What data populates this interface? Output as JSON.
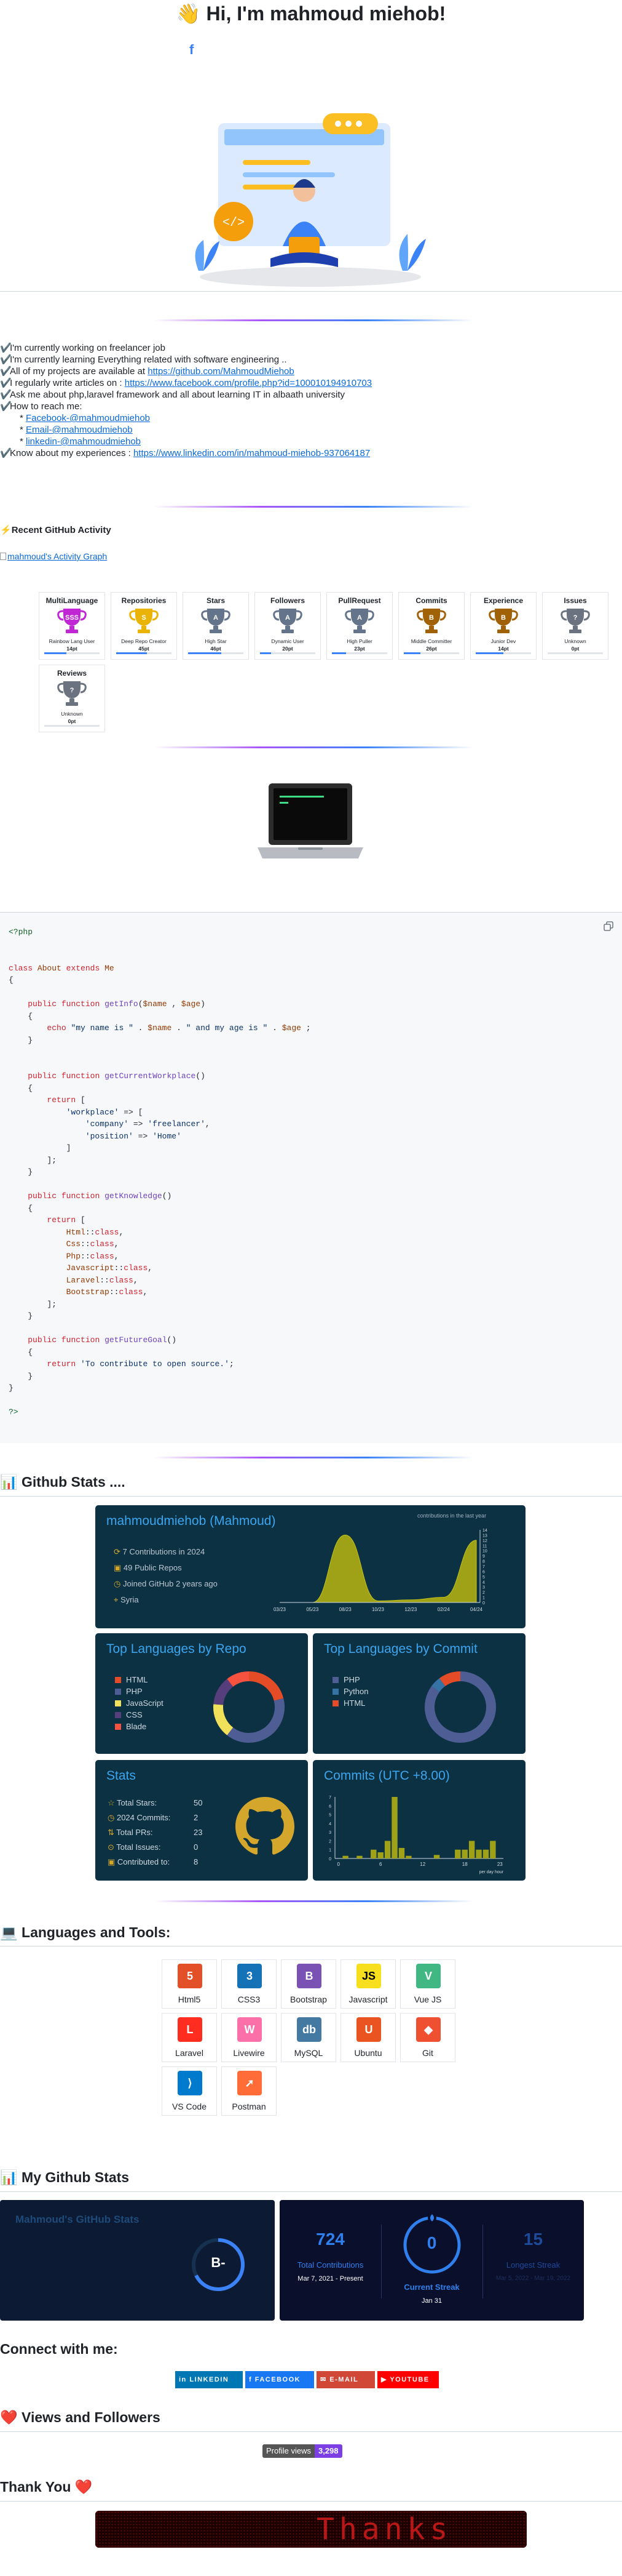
{
  "header": {
    "wave": "👋",
    "title": "Hi, I'm mahmoud miehob!",
    "fb_icon": "f"
  },
  "about": {
    "items": [
      {
        "check": "✔️",
        "text": "I'm currently working on freelancer job"
      },
      {
        "check": "✔️",
        "text": "I'm currently learning Everything related with software engineering .."
      },
      {
        "check": "✔️",
        "text": "All of my projects are available at ",
        "link": "https://github.com/MahmoudMiehob"
      },
      {
        "check": "✔️",
        "text": "I regularly write articles on : ",
        "link": "https://www.facebook.com/profile.php?id=100010194910703"
      },
      {
        "check": "✔️",
        "text": "Ask me about php,laravel framework and all about learning IT in albaath university"
      },
      {
        "check": "✔️",
        "text": "How to reach me:"
      }
    ],
    "contacts": [
      "Facebook-@mahmoudmiehob",
      "Email-@mahmoudmiehob",
      "linkedin-@mahmoudmiehob"
    ],
    "experience_prefix": "Know about my experiences : ",
    "experience_link": "https://www.linkedin.com/in/mahmoud-miehob-937064187"
  },
  "activity": {
    "icon": "⚡",
    "title": "Recent GitHub Activity",
    "graph_alt": "mahmoud's Activity Graph"
  },
  "trophies": [
    {
      "title": "MultiLanguage",
      "label": "Rainbow Lang User",
      "pts": "14pt",
      "rank": "SSS",
      "color": "#c026d3",
      "progress": 0.4
    },
    {
      "title": "Repositories",
      "label": "Deep Repo Creator",
      "pts": "45pt",
      "rank": "S",
      "color": "#eab308",
      "progress": 0.55
    },
    {
      "title": "Stars",
      "label": "High Star",
      "pts": "46pt",
      "rank": "A",
      "color": "#64748b",
      "progress": 0.6
    },
    {
      "title": "Followers",
      "label": "Dynamic User",
      "pts": "20pt",
      "rank": "A",
      "color": "#64748b",
      "progress": 0.2
    },
    {
      "title": "PullRequest",
      "label": "High Puller",
      "pts": "23pt",
      "rank": "A",
      "color": "#64748b",
      "progress": 0.25
    },
    {
      "title": "Commits",
      "label": "Middle Committer",
      "pts": "26pt",
      "rank": "B",
      "color": "#a16207",
      "progress": 0.3
    },
    {
      "title": "Experience",
      "label": "Junior Dev",
      "pts": "14pt",
      "rank": "B",
      "color": "#a16207",
      "progress": 0.5
    },
    {
      "title": "Issues",
      "label": "Unknown",
      "pts": "0pt",
      "rank": "?",
      "color": "#6b7280",
      "progress": 0
    },
    {
      "title": "Reviews",
      "label": "Unknown",
      "pts": "0pt",
      "rank": "?",
      "color": "#6b7280",
      "progress": 0
    }
  ],
  "code": {
    "copy_icon": "copy-icon",
    "lines": [
      "<?php",
      "",
      "",
      "class About extends Me",
      "{",
      "",
      "    public function getInfo($name , $age)",
      "    {",
      "        echo \"my name is \" . $name . \" and my age is \" . $age ;",
      "    }",
      "",
      "",
      "    public function getCurrentWorkplace()",
      "    {",
      "        return [",
      "            'workplace' => [",
      "                'company' => 'freelancer',",
      "                'position' => 'Home'",
      "            ]",
      "        ];",
      "    }",
      "",
      "    public function getKnowledge()",
      "    {",
      "        return [",
      "            Html::class,",
      "            Css::class,",
      "            Php::class,",
      "            Javascript::class,",
      "            Laravel::class,",
      "            Bootstrap::class,",
      "        ];",
      "    }",
      "",
      "    public function getFutureGoal()",
      "    {",
      "        return 'To contribute to open source.';",
      "    }",
      "}",
      "",
      "?>"
    ]
  },
  "github_stats": {
    "icon": "📊",
    "title": "Github Stats ....",
    "profile": {
      "name": "mahmoudmiehob (Mahmoud)",
      "graph_label": "contributions in the last year",
      "lines": [
        "7 Contributions in 2024",
        "49 Public Repos",
        "Joined GitHub 2 years ago",
        "Syria"
      ],
      "x_ticks": [
        "03/23",
        "05/23",
        "08/23",
        "10/23",
        "12/23",
        "02/24",
        "04/24"
      ],
      "y_ticks": [
        "14",
        "13",
        "12",
        "11",
        "10",
        "9",
        "8",
        "7",
        "6",
        "5",
        "4",
        "3",
        "2",
        "1",
        "0"
      ],
      "chart_data": {
        "type": "area",
        "x": [
          "03/23",
          "05/23",
          "08/23",
          "10/23",
          "12/23",
          "02/24",
          "04/24"
        ],
        "values": [
          0,
          0,
          13,
          0.3,
          0.5,
          1,
          12
        ],
        "ylim": [
          0,
          14
        ]
      }
    },
    "langs_repo": {
      "title": "Top Languages by Repo",
      "items": [
        {
          "name": "HTML",
          "color": "#e34c26",
          "value": 8
        },
        {
          "name": "PHP",
          "color": "#4f5d95",
          "value": 15
        },
        {
          "name": "JavaScript",
          "color": "#f1e05a",
          "value": 6
        },
        {
          "name": "CSS",
          "color": "#563d7c",
          "value": 5
        },
        {
          "name": "Blade",
          "color": "#f7523f",
          "value": 4
        }
      ]
    },
    "langs_commit": {
      "title": "Top Languages by Commit",
      "items": [
        {
          "name": "PHP",
          "color": "#4f5d95",
          "value": 85
        },
        {
          "name": "Python",
          "color": "#3572a5",
          "value": 5
        },
        {
          "name": "HTML",
          "color": "#e34c26",
          "value": 10
        }
      ]
    },
    "stats": {
      "title": "Stats",
      "rows": [
        {
          "label": "Total Stars:",
          "value": "50"
        },
        {
          "label": "2024 Commits:",
          "value": "2"
        },
        {
          "label": "Total PRs:",
          "value": "23"
        },
        {
          "label": "Total Issues:",
          "value": "0"
        },
        {
          "label": "Contributed to:",
          "value": "8"
        }
      ]
    },
    "commits": {
      "title": "Commits (UTC +8.00)",
      "x_ticks": [
        "0",
        "6",
        "12",
        "18",
        "23"
      ],
      "y_ticks": [
        "7",
        "6",
        "5",
        "4",
        "3",
        "2",
        "1",
        "0"
      ],
      "footer": "per day hour",
      "chart_data": {
        "type": "bar",
        "x": [
          0,
          1,
          2,
          3,
          4,
          5,
          6,
          7,
          8,
          9,
          10,
          11,
          12,
          13,
          14,
          15,
          16,
          17,
          18,
          19,
          20,
          21,
          22,
          23
        ],
        "values": [
          0,
          0.3,
          0,
          0.3,
          0,
          1,
          0.7,
          2,
          7,
          1.2,
          0.3,
          0,
          0,
          0,
          0.4,
          0,
          0,
          1,
          1,
          2,
          1,
          1,
          2,
          0
        ],
        "ylim": [
          0,
          7
        ]
      }
    }
  },
  "tools": {
    "icon": "💻",
    "title": "Languages and Tools:",
    "items": [
      {
        "name": "Html5",
        "glyph": "5",
        "color": "#e34f26"
      },
      {
        "name": "CSS3",
        "glyph": "3",
        "color": "#1572b6"
      },
      {
        "name": "Bootstrap",
        "glyph": "B",
        "color": "#7952b3"
      },
      {
        "name": "Javascript",
        "glyph": "JS",
        "color": "#f7df1e"
      },
      {
        "name": "Vue JS",
        "glyph": "V",
        "color": "#41b883"
      },
      {
        "name": "Laravel",
        "glyph": "L",
        "color": "#ff2d20"
      },
      {
        "name": "Livewire",
        "glyph": "W",
        "color": "#fb70a9"
      },
      {
        "name": "MySQL",
        "glyph": "db",
        "color": "#4479a1"
      },
      {
        "name": "Ubuntu",
        "glyph": "U",
        "color": "#e95420"
      },
      {
        "name": "Git",
        "glyph": "◆",
        "color": "#f05032"
      },
      {
        "name": "VS Code",
        "glyph": "⟩",
        "color": "#007acc"
      },
      {
        "name": "Postman",
        "glyph": "➚",
        "color": "#ff6c37"
      }
    ]
  },
  "mystats": {
    "icon": "📊",
    "title": "My Github Stats",
    "card_title": "Mahmoud's GitHub Stats",
    "grade": "B-",
    "total_contrib": "724",
    "total_label": "Total Contributions",
    "total_range": "Mar 7, 2021 - Present",
    "streak": "0",
    "streak_label": "Current Streak",
    "streak_date": "Jan 31",
    "longest": "15",
    "longest_label": "Longest Streak",
    "longest_range": "Mar 5, 2022 - Mar 19, 2022"
  },
  "connect": {
    "title": "Connect with me:",
    "badges": [
      {
        "name": "LINKEDIN",
        "icon": "in",
        "color": "#0077b5"
      },
      {
        "name": "FACEBOOK",
        "icon": "f",
        "color": "#1877f2"
      },
      {
        "name": "E-MAIL",
        "icon": "✉",
        "color": "#d14836"
      },
      {
        "name": "YOUTUBE",
        "icon": "▶",
        "color": "#ff0000"
      }
    ]
  },
  "views": {
    "icon": "❤️",
    "title": "Views and Followers",
    "label": "Profile views",
    "count": "3,298"
  },
  "thanks": {
    "title": "Thank You",
    "heart": "❤️",
    "banner_text": "Thanks"
  }
}
